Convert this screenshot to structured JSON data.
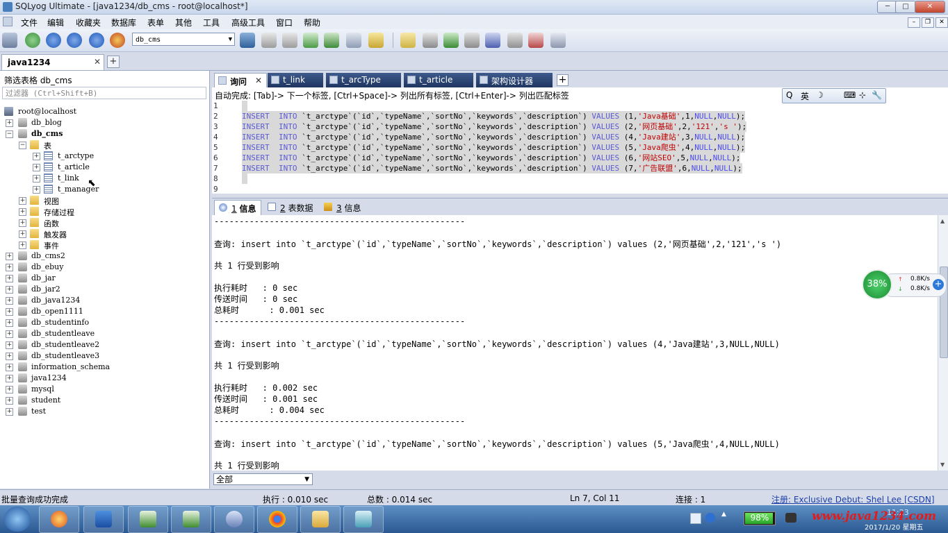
{
  "window": {
    "title": "SQLyog Ultimate - [java1234/db_cms - root@localhost*]",
    "controls": {
      "minimize": "─",
      "maximize": "□",
      "close": "✕"
    }
  },
  "menu": [
    "文件",
    "编辑",
    "收藏夹",
    "数据库",
    "表单",
    "其他",
    "工具",
    "高级工具",
    "窗口",
    "帮助"
  ],
  "mdi_controls": {
    "minimize": "–",
    "restore": "❐",
    "close": "✕"
  },
  "toolbar": {
    "database_selected": "db_cms",
    "dropdown_arrow": "▼"
  },
  "connection_tab": {
    "label": "java1234",
    "close": "✕",
    "add": "+"
  },
  "object_browser": {
    "filter_label": "筛选表格 db_cms",
    "filter_placeholder": "过滤器 (Ctrl+Shift+B)",
    "root": "root@localhost",
    "databases_before": [
      "db_blog"
    ],
    "current_db": "db_cms",
    "tables_folder": "表",
    "tables": [
      "t_arctype",
      "t_article",
      "t_link",
      "t_manager"
    ],
    "folders": [
      "视图",
      "存储过程",
      "函数",
      "触发器",
      "事件"
    ],
    "databases_after": [
      "db_cms2",
      "db_ebuy",
      "db_jar",
      "db_jar2",
      "db_java1234",
      "db_open1111",
      "db_studentinfo",
      "db_studentleave",
      "db_studentleave2",
      "db_studentleave3",
      "information_schema",
      "java1234",
      "mysql",
      "student",
      "test"
    ],
    "expand_plus": "+",
    "expand_minus": "−"
  },
  "editor_tabs": [
    {
      "label": "询问",
      "icon": "query-icon",
      "close": "✕",
      "active": true
    },
    {
      "label": "t_link",
      "icon": "table-icon",
      "active": false
    },
    {
      "label": "t_arcType",
      "icon": "table-icon",
      "active": false
    },
    {
      "label": "t_article",
      "icon": "table-icon",
      "active": false
    },
    {
      "label": "架构设计器",
      "icon": "schema-icon",
      "active": false
    }
  ],
  "editor_tab_add": "+",
  "editor": {
    "autocomplete_hint": "自动完成: [Tab]-> 下一个标签, [Ctrl+Space]-> 列出所有标签, [Ctrl+Enter]-> 列出匹配标签",
    "line_numbers": [
      "1",
      "2",
      "3",
      "4",
      "5",
      "6",
      "7",
      "8",
      "9"
    ],
    "code_prefix": "INSERT  INTO `t_arctype`(`id`,`typeName`,`sortNo`,`keywords`,`description`) VALUES ",
    "lines": [
      {
        "kw1": "INSERT",
        "kw2": "INTO",
        "body": "`t_arctype`(`id`,`typeName`,`sortNo`,`keywords`,`description`)",
        "kw3": "VALUES",
        "open": "(1,",
        "s1": "'Java基础'",
        "mid": ",1,",
        "n1": "NULL",
        "c": ",",
        "n2": "NULL",
        "end": ");"
      },
      {
        "kw1": "INSERT",
        "kw2": "INTO",
        "body": "`t_arctype`(`id`,`typeName`,`sortNo`,`keywords`,`description`)",
        "kw3": "VALUES",
        "open": "(2,",
        "s1": "'网页基础'",
        "mid": ",2,",
        "n1": "'121'",
        "c": ",",
        "n2": "'s '",
        "end": ");"
      },
      {
        "kw1": "INSERT",
        "kw2": "INTO",
        "body": "`t_arctype`(`id`,`typeName`,`sortNo`,`keywords`,`description`)",
        "kw3": "VALUES",
        "open": "(4,",
        "s1": "'Java建站'",
        "mid": ",3,",
        "n1": "NULL",
        "c": ",",
        "n2": "NULL",
        "end": ");"
      },
      {
        "kw1": "INSERT",
        "kw2": "INTO",
        "body": "`t_arctype`(`id`,`typeName`,`sortNo`,`keywords`,`description`)",
        "kw3": "VALUES",
        "open": "(5,",
        "s1": "'Java爬虫'",
        "mid": ",4,",
        "n1": "NULL",
        "c": ",",
        "n2": "NULL",
        "end": ");"
      },
      {
        "kw1": "INSERT",
        "kw2": "INTO",
        "body": "`t_arctype`(`id`,`typeName`,`sortNo`,`keywords`,`description`)",
        "kw3": "VALUES",
        "open": "(6,",
        "s1": "'网站SEO'",
        "mid": ",5,",
        "n1": "NULL",
        "c": ",",
        "n2": "NULL",
        "end": ");"
      },
      {
        "kw1": "INSERT",
        "kw2": "INTO",
        "body": "`t_arctype`(`id`,`typeName`,`sortNo`,`keywords`,`description`)",
        "kw3": "VALUES",
        "open": "(7,",
        "s1": "'广告联盟'",
        "mid": ",6,",
        "n1": "NULL",
        "c": ",",
        "n2": "NULL",
        "end": ");"
      }
    ]
  },
  "ime_bar": {
    "q": "Q",
    "lang": "英",
    "moon": "☽",
    "kbd": "⌨",
    "sym": "⊹",
    "tool": "🔧"
  },
  "result_tabs": [
    {
      "num": "1",
      "label": "信息",
      "active": true
    },
    {
      "num": "2",
      "label": "表数据",
      "active": false
    },
    {
      "num": "3",
      "label": "信息",
      "active": false
    }
  ],
  "results": {
    "separator": "--------------------------------------------------",
    "blocks": [
      {
        "query": "查询: insert into `t_arctype`(`id`,`typeName`,`sortNo`,`keywords`,`description`) values (2,'网页基础',2,'121','s ')",
        "affected": "共 1 行受到影响",
        "exec": "执行耗时   : 0 sec",
        "transfer": "传送时间   : 0 sec",
        "total": "总耗时      : 0.001 sec"
      },
      {
        "query": "查询: insert into `t_arctype`(`id`,`typeName`,`sortNo`,`keywords`,`description`) values (4,'Java建站',3,NULL,NULL)",
        "affected": "共 1 行受到影响",
        "exec": "执行耗时   : 0.002 sec",
        "transfer": "传送时间   : 0.001 sec",
        "total": "总耗时      : 0.004 sec"
      },
      {
        "query": "查询: insert into `t_arctype`(`id`,`typeName`,`sortNo`,`keywords`,`description`) values (5,'Java爬虫',4,NULL,NULL)",
        "affected": "共 1 行受到影响"
      }
    ],
    "filter_value": "全部",
    "scroll_up": "▲",
    "scroll_down": "▼"
  },
  "speed_widget": {
    "percent": "38%",
    "up_arrow": "↑",
    "down_arrow": "↓",
    "upload": "0.8K/s",
    "download": "0.8K/s",
    "plus": "+"
  },
  "status": {
    "message": "批量查询成功完成",
    "exec_time": "执行 : 0.010 sec",
    "total_time": "总数 : 0.014 sec",
    "position": "Ln 7, Col 11",
    "connections": "连接 : 1",
    "registration": "注册:  Exclusive Debut: Shel Lee [CSDN]"
  },
  "taskbar": {
    "battery": "98%",
    "watermark": "www.java1234.com",
    "time": "11:23",
    "date": "2017/1/20 星期五"
  }
}
